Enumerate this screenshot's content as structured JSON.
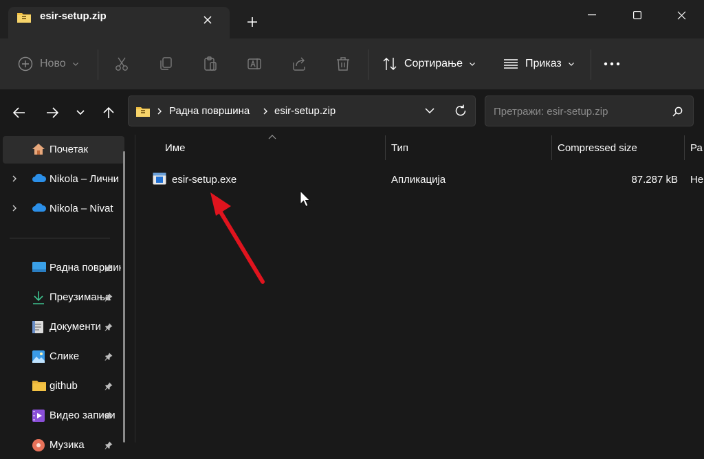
{
  "window": {
    "tab_title": "esir-setup.zip"
  },
  "toolbar": {
    "new_label": "Ново",
    "sort_label": "Сортирање",
    "view_label": "Приказ"
  },
  "address": {
    "crumbs": [
      "Радна површина",
      "esir-setup.zip"
    ]
  },
  "search": {
    "placeholder": "Претражи: esir-setup.zip"
  },
  "sidebar": {
    "home": "Почетак",
    "cloud": [
      "Nikola – Лични",
      "Nikola – Nivat"
    ],
    "pinned": [
      {
        "label": "Радна површина",
        "icon": "desktop-icon"
      },
      {
        "label": "Преузимања",
        "icon": "download-icon"
      },
      {
        "label": "Документи",
        "icon": "document-icon"
      },
      {
        "label": "Слике",
        "icon": "pictures-icon"
      },
      {
        "label": "github",
        "icon": "folder-icon"
      },
      {
        "label": "Видео записи",
        "icon": "video-icon"
      },
      {
        "label": "Музика",
        "icon": "music-icon"
      }
    ]
  },
  "table": {
    "columns": [
      "Име",
      "Тип",
      "Compressed size",
      "Ра"
    ],
    "rows": [
      {
        "name": "esir-setup.exe",
        "type": "Апликација",
        "compressed": "87.287 kB",
        "extra": "Не"
      }
    ]
  },
  "colors": {
    "accent": "#4aa3ff",
    "arrow": "#e0141e",
    "folder": "#f3c244"
  }
}
